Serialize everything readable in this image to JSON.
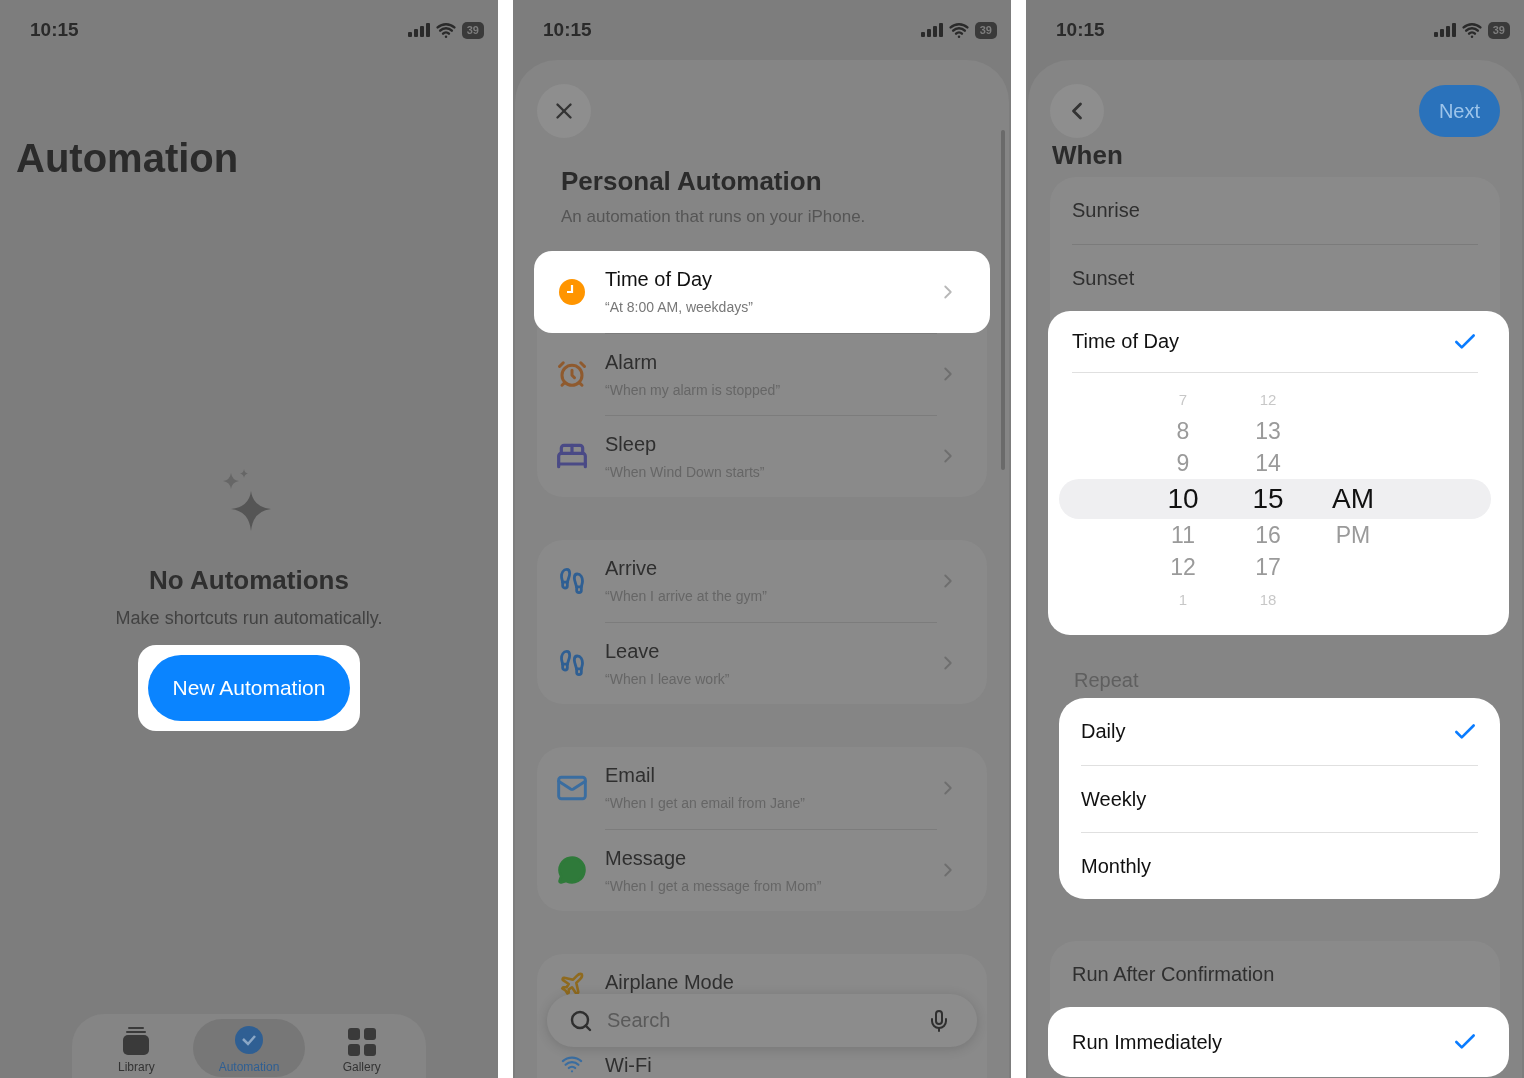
{
  "automation_screen": {
    "status_bar": {
      "time": "10:15",
      "battery": "39"
    },
    "title": "Automation",
    "empty_state": {
      "title": "No Automations",
      "subtitle": "Make shortcuts run automatically."
    },
    "new_automation_button": {
      "label": "New Automation",
      "highlighted": true
    },
    "tab_bar": [
      {
        "label": "Library",
        "selected": false
      },
      {
        "label": "Automation",
        "selected": true
      },
      {
        "label": "Gallery",
        "selected": false
      }
    ]
  },
  "personal_automation_sheet": {
    "status_bar": {
      "time": "10:15",
      "battery": "39"
    },
    "title": "Personal Automation",
    "subtitle": "An automation that runs on your iPhone.",
    "groups": [
      {
        "rows": [
          {
            "title": "Time of Day",
            "subtitle": "“At 8:00 AM, weekdays”",
            "highlighted": true
          },
          {
            "title": "Alarm",
            "subtitle": "“When my alarm is stopped”",
            "highlighted": false
          },
          {
            "title": "Sleep",
            "subtitle": "“When Wind Down starts”",
            "highlighted": false
          }
        ]
      },
      {
        "rows": [
          {
            "title": "Arrive",
            "subtitle": "“When I arrive at the gym”",
            "highlighted": false
          },
          {
            "title": "Leave",
            "subtitle": "“When I leave work”",
            "highlighted": false
          }
        ]
      },
      {
        "rows": [
          {
            "title": "Email",
            "subtitle": "“When I get an email from Jane”",
            "highlighted": false
          },
          {
            "title": "Message",
            "subtitle": "“When I get a message from Mom”",
            "highlighted": false
          }
        ]
      },
      {
        "rows": [
          {
            "title": "Airplane Mode",
            "highlighted": false
          },
          {
            "title": "Wi-Fi",
            "highlighted": false
          }
        ]
      }
    ],
    "search": {
      "placeholder": "Search"
    }
  },
  "when_sheet": {
    "status_bar": {
      "time": "10:15",
      "battery": "39"
    },
    "next_button": "Next",
    "title": "When",
    "trigger_options": [
      {
        "kind": "plain",
        "label": "Sunrise",
        "checked": false,
        "highlighted": false
      },
      {
        "kind": "plain",
        "label": "Sunset",
        "checked": false,
        "highlighted": false
      },
      {
        "kind": "time_picker",
        "label": "Time of Day",
        "checked": true,
        "highlighted": true,
        "picker": [
          {
            "values": [
              {
                "value": "7",
                "selected": false
              },
              {
                "value": "8",
                "selected": false
              },
              {
                "value": "9",
                "selected": false
              },
              {
                "value": "10",
                "selected": true
              },
              {
                "value": "11",
                "selected": false
              },
              {
                "value": "12",
                "selected": false
              },
              {
                "value": "1",
                "selected": false
              }
            ]
          },
          {
            "values": [
              {
                "value": "12",
                "selected": false
              },
              {
                "value": "13",
                "selected": false
              },
              {
                "value": "14",
                "selected": false
              },
              {
                "value": "15",
                "selected": true
              },
              {
                "value": "16",
                "selected": false
              },
              {
                "value": "17",
                "selected": false
              },
              {
                "value": "18",
                "selected": false
              }
            ]
          },
          {
            "values": [
              {
                "value": "AM",
                "selected": true
              },
              {
                "value": "PM",
                "selected": false
              }
            ]
          }
        ]
      }
    ],
    "repeat": {
      "header": "Repeat",
      "highlighted": true,
      "options": [
        {
          "label": "Daily",
          "checked": true
        },
        {
          "label": "Weekly",
          "checked": false
        },
        {
          "label": "Monthly",
          "checked": false
        }
      ]
    },
    "run_options": [
      {
        "label": "Run After Confirmation",
        "checked": false,
        "highlighted": false
      },
      {
        "label": "Run Immediately",
        "checked": true,
        "highlighted": true
      }
    ]
  }
}
